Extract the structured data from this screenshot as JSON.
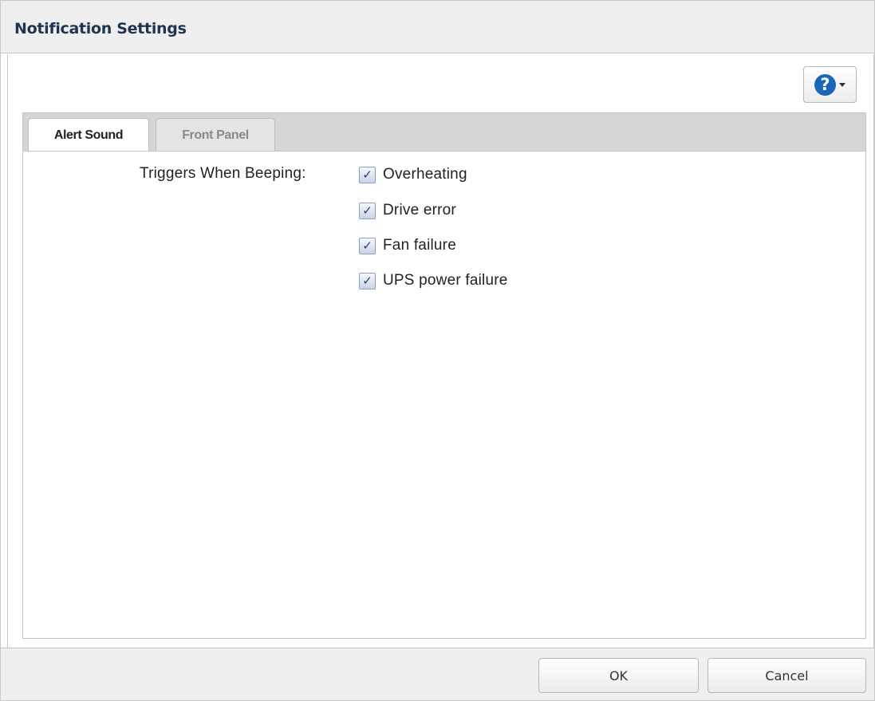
{
  "window": {
    "title": "Notification Settings"
  },
  "help": {
    "icon": "help-icon",
    "glyph": "?",
    "accent": "#1766b8"
  },
  "tabs": [
    {
      "label": "Alert Sound",
      "active": true
    },
    {
      "label": "Front Panel",
      "active": false
    }
  ],
  "alert_sound": {
    "field_label": "Triggers When Beeping:",
    "options": [
      {
        "label": "Overheating",
        "checked": true
      },
      {
        "label": "Drive error",
        "checked": true
      },
      {
        "label": "Fan failure",
        "checked": true
      },
      {
        "label": "UPS power failure",
        "checked": true
      }
    ]
  },
  "footer": {
    "ok_label": "OK",
    "cancel_label": "Cancel"
  }
}
